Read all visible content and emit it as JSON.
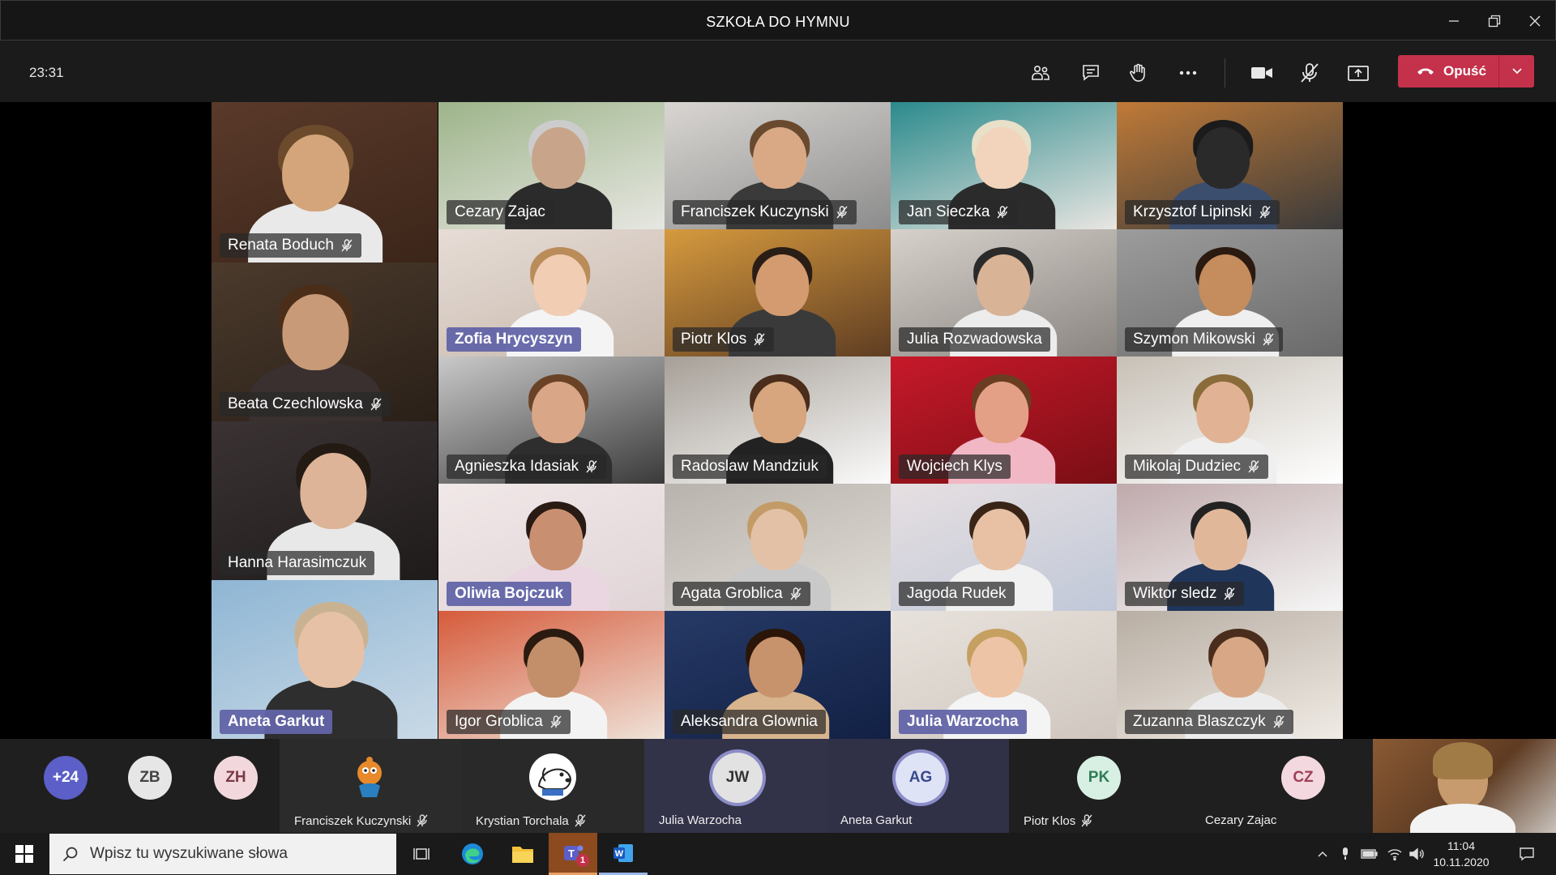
{
  "window": {
    "title": "SZKOŁA DO HYMNU"
  },
  "toolbar": {
    "timer": "23:31",
    "leave_label": "Opuść"
  },
  "tiles": [
    {
      "name": "Renata Boduch",
      "muted": true,
      "active": false
    },
    {
      "name": "Cezary Zajac",
      "muted": false,
      "active": false
    },
    {
      "name": "Franciszek Kuczynski",
      "muted": true,
      "active": false
    },
    {
      "name": "Jan Sieczka",
      "muted": true,
      "active": false
    },
    {
      "name": "Krzysztof Lipinski",
      "muted": true,
      "active": false
    },
    {
      "name": "Zofia Hrycyszyn",
      "muted": false,
      "active": true
    },
    {
      "name": "Piotr Klos",
      "muted": true,
      "active": false
    },
    {
      "name": "Julia Rozwadowska",
      "muted": false,
      "active": false
    },
    {
      "name": "Szymon Mikowski",
      "muted": true,
      "active": false
    },
    {
      "name": "Beata Czechlowska",
      "muted": true,
      "active": false
    },
    {
      "name": "Agnieszka Idasiak",
      "muted": true,
      "active": false
    },
    {
      "name": "Radoslaw Mandziuk",
      "muted": false,
      "active": false
    },
    {
      "name": "Wojciech Klys",
      "muted": false,
      "active": false
    },
    {
      "name": "Mikolaj Dudziec",
      "muted": true,
      "active": false
    },
    {
      "name": "Hanna Harasimczuk",
      "muted": false,
      "active": false
    },
    {
      "name": "Oliwia Bojczuk",
      "muted": false,
      "active": true
    },
    {
      "name": "Agata Groblica",
      "muted": true,
      "active": false
    },
    {
      "name": "Jagoda Rudek",
      "muted": false,
      "active": false
    },
    {
      "name": "Wiktor sledz",
      "muted": true,
      "active": false
    },
    {
      "name": "Aneta Garkut",
      "muted": false,
      "active": true
    },
    {
      "name": "Igor Groblica",
      "muted": true,
      "active": false
    },
    {
      "name": "Aleksandra Glownia",
      "muted": false,
      "active": false
    },
    {
      "name": "Julia Warzocha",
      "muted": false,
      "active": true
    },
    {
      "name": "Zuzanna Blaszczyk",
      "muted": true,
      "active": false
    }
  ],
  "strip": {
    "overflow": "+24",
    "avatars": [
      {
        "initials": "ZB"
      },
      {
        "initials": "ZH"
      }
    ],
    "participants": [
      {
        "name": "Franciszek Kuczynski",
        "muted": true,
        "initials": ""
      },
      {
        "name": "Krystian Torchala",
        "muted": true,
        "initials": ""
      },
      {
        "name": "Julia Warzocha",
        "muted": false,
        "initials": "JW"
      },
      {
        "name": "Aneta Garkut",
        "muted": false,
        "initials": "AG"
      },
      {
        "name": "Piotr Klos",
        "muted": true,
        "initials": "PK"
      },
      {
        "name": "Cezary Zajac",
        "muted": false,
        "initials": "CZ"
      }
    ]
  },
  "taskbar": {
    "search_placeholder": "Wpisz tu wyszukiwane słowa",
    "teams_badge": "1",
    "time": "11:04",
    "date": "10.11.2020"
  },
  "colors": {
    "leave": "#c4314b",
    "active_tag": "#6264a7",
    "accent_ring": "#8b8cc7"
  }
}
